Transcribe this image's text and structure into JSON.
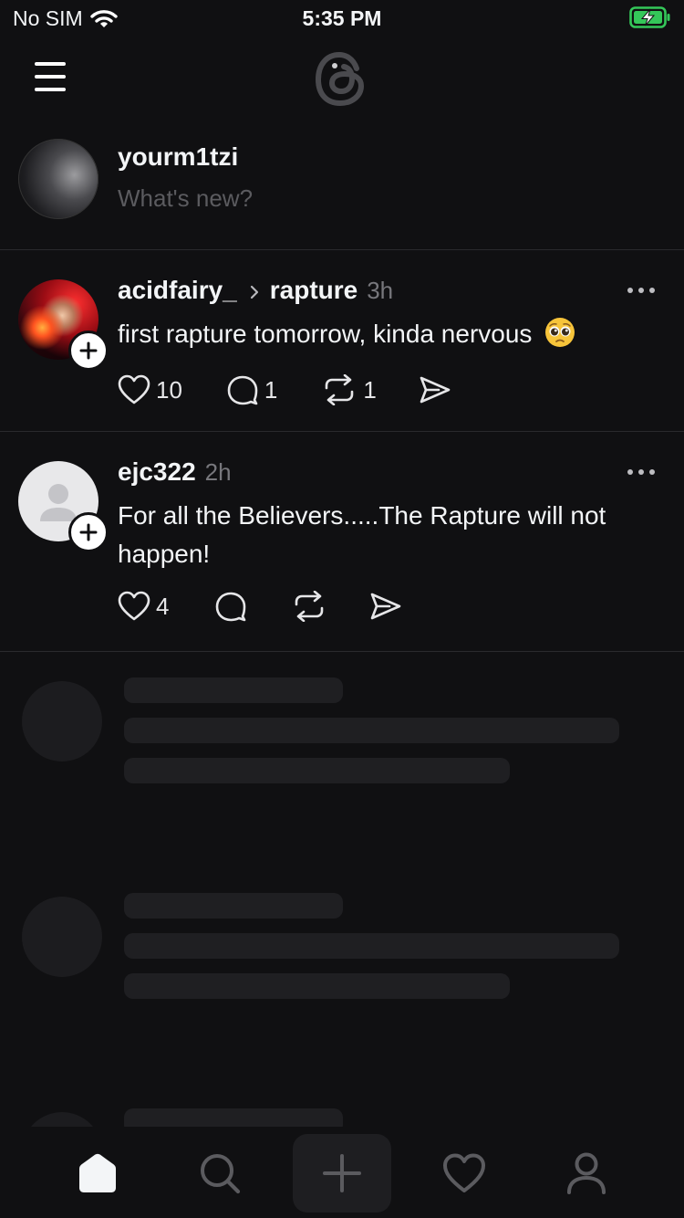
{
  "status_bar": {
    "carrier": "No SIM",
    "time": "5:35 PM"
  },
  "composer": {
    "username": "yourm1tzi",
    "placeholder": "What's new?"
  },
  "posts": [
    {
      "username": "acidfairy_",
      "community": "rapture",
      "time": "3h",
      "text": "first rapture tomorrow, kinda nervous",
      "emoji": "pleading-face",
      "likes": "10",
      "replies": "1",
      "reposts": "1"
    },
    {
      "username": "ejc322",
      "time": "2h",
      "text": "For all the Believers.....The Rapture will not happen!",
      "likes": "4"
    }
  ],
  "colors": {
    "background": "#101012",
    "text_primary": "#f3f5f7",
    "text_secondary": "#77777c",
    "placeholder": "#5b5b5f",
    "divider": "#2a2a2d",
    "battery_green": "#34c759"
  },
  "tab_bar": {
    "tabs": [
      "home-icon",
      "search-icon",
      "new-thread-icon",
      "activity-heart-icon",
      "profile-icon"
    ],
    "active": "home-icon"
  }
}
